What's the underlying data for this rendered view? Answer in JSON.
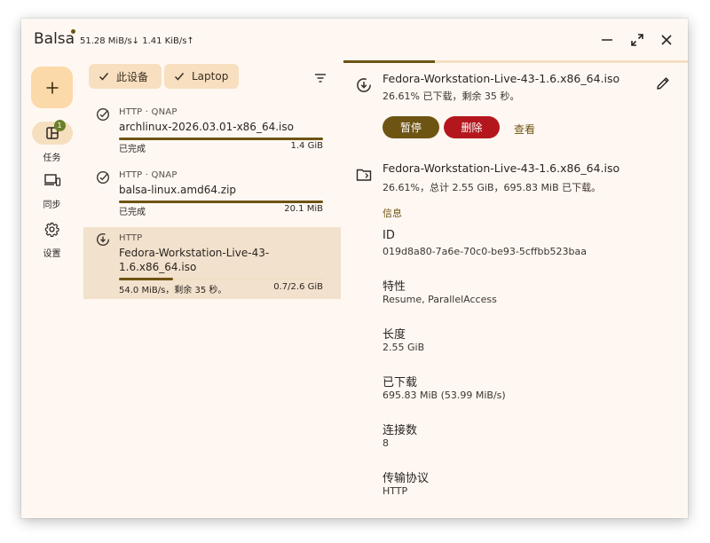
{
  "app": {
    "title": "Balsa",
    "speed": "51.28 MiB/s↓ 1.41 KiB/s↑"
  },
  "window_controls": {
    "minimize": "minimize",
    "maximize": "maximize",
    "close": "close"
  },
  "nav": {
    "items": [
      {
        "label": "任务",
        "badge": "1",
        "icon": "tasks-icon"
      },
      {
        "label": "同步",
        "icon": "devices-icon"
      },
      {
        "label": "设置",
        "icon": "gear-icon"
      }
    ]
  },
  "filters": {
    "chips": [
      {
        "label": "此设备"
      },
      {
        "label": "Laptop"
      }
    ]
  },
  "downloads": [
    {
      "source": "HTTP · QNAP",
      "name": "archlinux-2026.03.01-x86_64.iso",
      "status": "已完成",
      "size": "1.4 GiB",
      "progress": 1.0
    },
    {
      "source": "HTTP · QNAP",
      "name": "balsa-linux.amd64.zip",
      "status": "已完成",
      "size": "20.1 MiB",
      "progress": 1.0
    },
    {
      "source": "HTTP",
      "name": "Fedora-Workstation-Live-43-1.6.x86_64.iso",
      "status": "54.0 MiB/s，剩余 35 秒。",
      "size": "0.7/2.6 GiB",
      "progress": 0.2661
    }
  ],
  "detail": {
    "progress": 0.2661,
    "title": "Fedora-Workstation-Live-43-1.6.x86_64.iso",
    "subtitle": "26.61% 已下载，剩余 35 秒。",
    "pause_label": "暂停",
    "delete_label": "删除",
    "view_label": "查看",
    "file_title": "Fedora-Workstation-Live-43-1.6.x86_64.iso",
    "file_subtitle": "26.61%，总计 2.55 GiB，695.83 MiB 已下载。",
    "info_header": "信息",
    "properties": [
      {
        "label": "ID",
        "value": "019d8a80-7a6e-70c0-be93-5cffbb523baa"
      },
      {
        "label": "特性",
        "value": "Resume, ParallelAccess"
      },
      {
        "label": "长度",
        "value": "2.55 GiB"
      },
      {
        "label": "已下载",
        "value": "695.83 MiB (53.99 MiB/s)"
      },
      {
        "label": "连接数",
        "value": "8"
      },
      {
        "label": "传输协议",
        "value": "HTTP"
      }
    ]
  },
  "colors": {
    "accent": "#6e5413",
    "danger": "#b3171d",
    "window_bg": "#fff8f2",
    "chip_bg": "#f7dfc0",
    "fab_bg": "#fcd9a9",
    "selected_bg": "#f2e1cc"
  }
}
